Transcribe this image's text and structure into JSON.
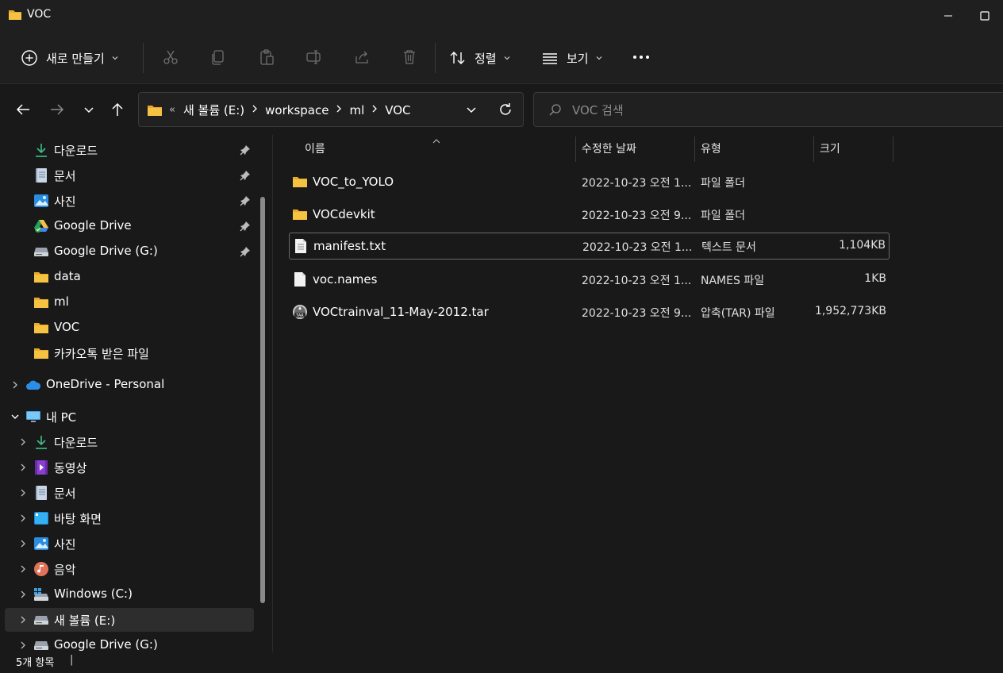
{
  "window": {
    "title": "VOC"
  },
  "toolbar": {
    "new_label": "새로 만들기",
    "sort_label": "정렬",
    "view_label": "보기"
  },
  "address": {
    "overflow": "«",
    "crumbs": [
      "새 볼륨 (E:)",
      "workspace",
      "ml",
      "VOC"
    ]
  },
  "search": {
    "placeholder": "VOC 검색"
  },
  "sidebar": {
    "quick": [
      {
        "label": "다운로드",
        "icon": "download-icon"
      },
      {
        "label": "문서",
        "icon": "document-icon"
      },
      {
        "label": "사진",
        "icon": "pictures-icon"
      },
      {
        "label": "Google Drive",
        "icon": "google-drive-icon"
      },
      {
        "label": "Google Drive (G:)",
        "icon": "drive-icon"
      },
      {
        "label": "data",
        "icon": "folder-icon"
      },
      {
        "label": "ml",
        "icon": "folder-icon"
      },
      {
        "label": "VOC",
        "icon": "folder-icon"
      },
      {
        "label": "카카오톡 받은 파일",
        "icon": "folder-icon"
      }
    ],
    "onedrive": "OneDrive - Personal",
    "thispc": "내 PC",
    "pc_items": [
      {
        "label": "다운로드",
        "icon": "download-icon"
      },
      {
        "label": "동영상",
        "icon": "videos-icon"
      },
      {
        "label": "문서",
        "icon": "document-icon"
      },
      {
        "label": "바탕 화면",
        "icon": "desktop-icon"
      },
      {
        "label": "사진",
        "icon": "pictures-icon"
      },
      {
        "label": "음악",
        "icon": "music-icon"
      },
      {
        "label": "Windows (C:)",
        "icon": "windows-drive-icon"
      },
      {
        "label": "새 볼륨 (E:)",
        "icon": "drive-icon"
      },
      {
        "label": "Google Drive (G:)",
        "icon": "drive-icon"
      }
    ]
  },
  "columns": {
    "name": "이름",
    "date": "수정한 날짜",
    "type": "유형",
    "size": "크기"
  },
  "files": [
    {
      "name": "VOC_to_YOLO",
      "date": "2022-10-23 오전 1...",
      "type": "파일 폴더",
      "size": "",
      "icon": "folder-icon"
    },
    {
      "name": "VOCdevkit",
      "date": "2022-10-23 오전 9...",
      "type": "파일 폴더",
      "size": "",
      "icon": "folder-icon"
    },
    {
      "name": "manifest.txt",
      "date": "2022-10-23 오전 1...",
      "type": "텍스트 문서",
      "size": "1,104KB",
      "icon": "text-file-icon"
    },
    {
      "name": "voc.names",
      "date": "2022-10-23 오전 1...",
      "type": "NAMES 파일",
      "size": "1KB",
      "icon": "file-icon"
    },
    {
      "name": "VOCtrainval_11-May-2012.tar",
      "date": "2022-10-23 오전 9...",
      "type": "압축(TAR) 파일",
      "size": "1,952,773KB",
      "icon": "tar-archive-icon"
    }
  ],
  "status": {
    "count": "5개 항목",
    "separator": "|"
  },
  "colors": {
    "background": "#191919",
    "folder": "#f5c242",
    "accent": "#4aa3df"
  }
}
